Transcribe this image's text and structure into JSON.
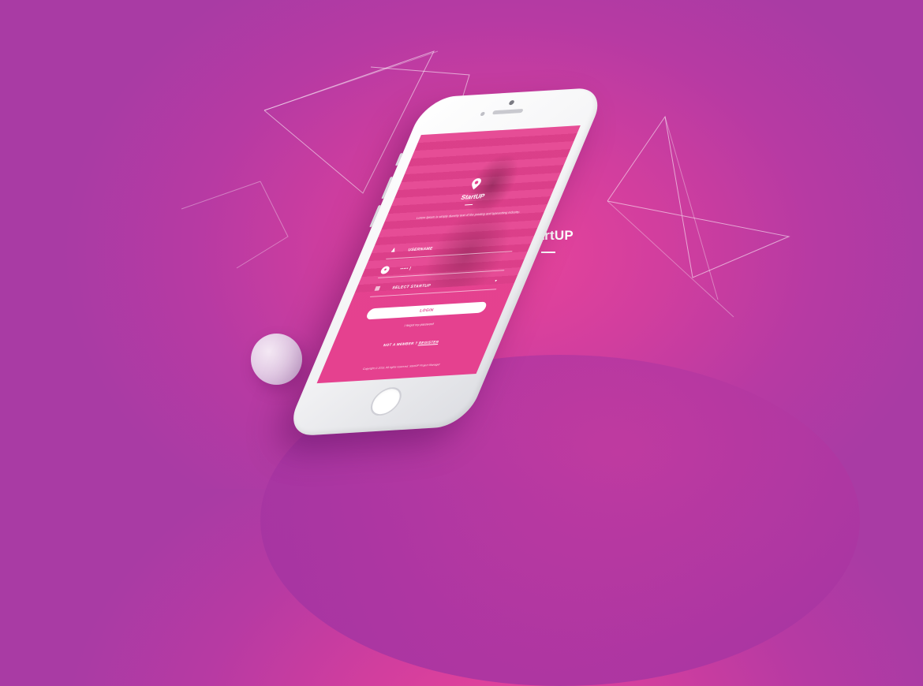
{
  "brand": {
    "title": "StartUP",
    "pin_icon": "location-pin-icon",
    "color": "#ffffff"
  },
  "app": {
    "title": "StartUP",
    "description": "Lorem Ipsum is simply dummy text of the printing and typesetting industry.",
    "fields": {
      "username": {
        "label": "USERNAME",
        "icon": "user-icon"
      },
      "password": {
        "value": "••••• |",
        "icon": "lock-icon"
      },
      "startup": {
        "label": "SELECT STARTUP",
        "icon": "calendar-icon"
      }
    },
    "login_label": "LOGIN",
    "forgot_label": "I forgot my password",
    "register_prefix": "NOT A MEMBER ?",
    "register_link": "REGISTER",
    "copyright": "Copyright © 2015. All rights reserved. StartUP Project Manager"
  },
  "colors": {
    "accent": "#e4428f",
    "background": "#b73aa3"
  }
}
